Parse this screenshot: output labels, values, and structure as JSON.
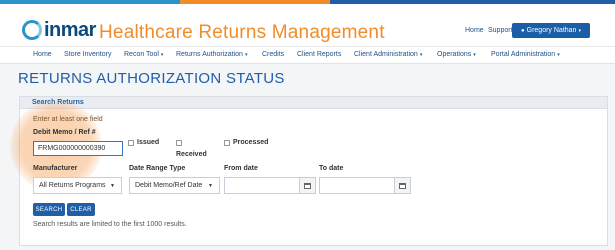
{
  "brand": {
    "logo_text": "inmar",
    "app_title": "Healthcare Returns Management",
    "accent_color": "#f28c28",
    "primary_color": "#1f5fa8"
  },
  "header_links": {
    "home": "Home",
    "support": "Support",
    "user_name": "Gregory Nathan"
  },
  "nav": {
    "items": [
      {
        "label": "Home",
        "has_menu": false
      },
      {
        "label": "Store Inventory",
        "has_menu": false
      },
      {
        "label": "Recon Tool",
        "has_menu": true
      },
      {
        "label": "Returns Authorization",
        "has_menu": true
      },
      {
        "label": "Credits",
        "has_menu": false
      },
      {
        "label": "Client Reports",
        "has_menu": false
      },
      {
        "label": "Client Administration",
        "has_menu": true
      },
      {
        "label": "Operations",
        "has_menu": true
      },
      {
        "label": "Portal Administration",
        "has_menu": true
      }
    ]
  },
  "page": {
    "title": "RETURNS AUTHORIZATION STATUS"
  },
  "search": {
    "panel_title": "Search Returns",
    "hint": "Enter at least one field",
    "debit_memo_label": "Debit Memo / Ref #",
    "debit_memo_value": "FRMG000000000390",
    "checkboxes": [
      {
        "label": "Issued",
        "checked": false
      },
      {
        "label": "Received",
        "checked": false
      },
      {
        "label": "Processed",
        "checked": false
      }
    ],
    "manufacturer_label": "Manufacturer",
    "manufacturer_value": "All Returns Programs",
    "date_range_type_label": "Date Range Type",
    "date_range_type_value": "Debit Memo/Ref Date",
    "from_date_label": "From date",
    "from_date_value": "",
    "to_date_label": "To date",
    "to_date_value": "",
    "search_button": "SEARCH",
    "clear_button": "CLEAR",
    "limit_note": "Search results are limited to the first 1000 results."
  },
  "icons": {
    "caret": "▾",
    "user": "user-icon",
    "calendar": "calendar-icon"
  }
}
